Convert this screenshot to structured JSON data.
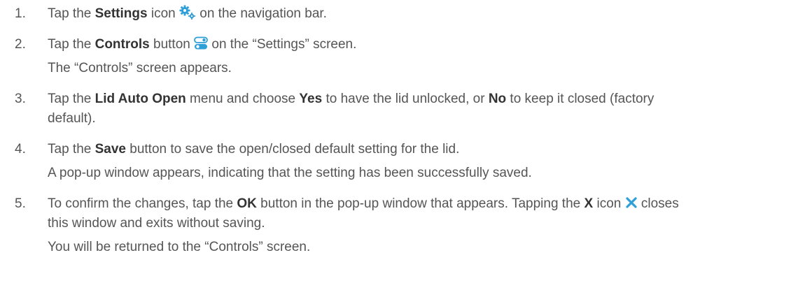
{
  "steps": [
    {
      "num": "1.",
      "t1": "Tap the ",
      "b1": "Settings",
      "t2": " icon ",
      "icon": "gears-icon",
      "t3": " on the navigation bar."
    },
    {
      "num": "2.",
      "t1": "Tap the ",
      "b1": "Controls",
      "t2": " button ",
      "icon": "toggles-icon",
      "t3": " on the “Settings” screen.",
      "sub": "The “Controls” screen appears."
    },
    {
      "num": "3.",
      "t1": "Tap the ",
      "b1": "Lid Auto Open",
      "t2": " menu and choose ",
      "b2": "Yes",
      "t3": " to have the lid unlocked, or ",
      "b3": "No",
      "t4": " to keep it closed (factory",
      "line2": "default)."
    },
    {
      "num": "4.",
      "t1": "Tap the ",
      "b1": "Save",
      "t2": " button to save the open/closed default setting for the lid.",
      "sub": "A pop-up window appears, indicating that the setting has been successfully saved."
    },
    {
      "num": "5.",
      "t1": "To confirm the changes, tap the ",
      "b1": "OK",
      "t2": " button in the pop-up window that appears. Tapping the ",
      "b2": "X",
      "t3": " icon ",
      "icon": "close-x-icon",
      "t4": " closes",
      "line2": "this window and exits without saving.",
      "sub": "You will be returned to the “Controls” screen."
    }
  ],
  "colors": {
    "text": "#555555",
    "bold": "#333333",
    "icon_blue": "#2f9fd8"
  }
}
